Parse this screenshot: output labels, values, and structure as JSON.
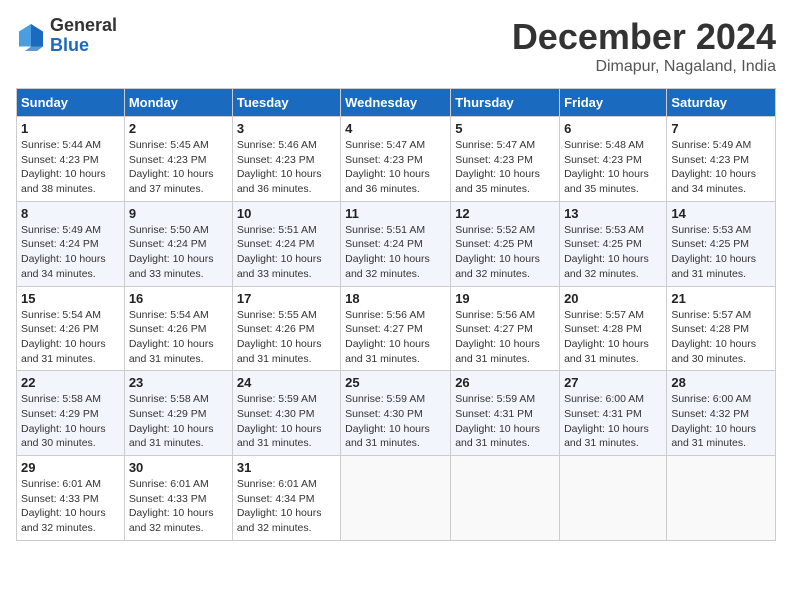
{
  "header": {
    "logo_general": "General",
    "logo_blue": "Blue",
    "month_title": "December 2024",
    "location": "Dimapur, Nagaland, India"
  },
  "days_of_week": [
    "Sunday",
    "Monday",
    "Tuesday",
    "Wednesday",
    "Thursday",
    "Friday",
    "Saturday"
  ],
  "weeks": [
    [
      {
        "day": "1",
        "sunrise": "5:44 AM",
        "sunset": "4:23 PM",
        "daylight": "10 hours and 38 minutes."
      },
      {
        "day": "2",
        "sunrise": "5:45 AM",
        "sunset": "4:23 PM",
        "daylight": "10 hours and 37 minutes."
      },
      {
        "day": "3",
        "sunrise": "5:46 AM",
        "sunset": "4:23 PM",
        "daylight": "10 hours and 36 minutes."
      },
      {
        "day": "4",
        "sunrise": "5:47 AM",
        "sunset": "4:23 PM",
        "daylight": "10 hours and 36 minutes."
      },
      {
        "day": "5",
        "sunrise": "5:47 AM",
        "sunset": "4:23 PM",
        "daylight": "10 hours and 35 minutes."
      },
      {
        "day": "6",
        "sunrise": "5:48 AM",
        "sunset": "4:23 PM",
        "daylight": "10 hours and 35 minutes."
      },
      {
        "day": "7",
        "sunrise": "5:49 AM",
        "sunset": "4:23 PM",
        "daylight": "10 hours and 34 minutes."
      }
    ],
    [
      {
        "day": "8",
        "sunrise": "5:49 AM",
        "sunset": "4:24 PM",
        "daylight": "10 hours and 34 minutes."
      },
      {
        "day": "9",
        "sunrise": "5:50 AM",
        "sunset": "4:24 PM",
        "daylight": "10 hours and 33 minutes."
      },
      {
        "day": "10",
        "sunrise": "5:51 AM",
        "sunset": "4:24 PM",
        "daylight": "10 hours and 33 minutes."
      },
      {
        "day": "11",
        "sunrise": "5:51 AM",
        "sunset": "4:24 PM",
        "daylight": "10 hours and 32 minutes."
      },
      {
        "day": "12",
        "sunrise": "5:52 AM",
        "sunset": "4:25 PM",
        "daylight": "10 hours and 32 minutes."
      },
      {
        "day": "13",
        "sunrise": "5:53 AM",
        "sunset": "4:25 PM",
        "daylight": "10 hours and 32 minutes."
      },
      {
        "day": "14",
        "sunrise": "5:53 AM",
        "sunset": "4:25 PM",
        "daylight": "10 hours and 31 minutes."
      }
    ],
    [
      {
        "day": "15",
        "sunrise": "5:54 AM",
        "sunset": "4:26 PM",
        "daylight": "10 hours and 31 minutes."
      },
      {
        "day": "16",
        "sunrise": "5:54 AM",
        "sunset": "4:26 PM",
        "daylight": "10 hours and 31 minutes."
      },
      {
        "day": "17",
        "sunrise": "5:55 AM",
        "sunset": "4:26 PM",
        "daylight": "10 hours and 31 minutes."
      },
      {
        "day": "18",
        "sunrise": "5:56 AM",
        "sunset": "4:27 PM",
        "daylight": "10 hours and 31 minutes."
      },
      {
        "day": "19",
        "sunrise": "5:56 AM",
        "sunset": "4:27 PM",
        "daylight": "10 hours and 31 minutes."
      },
      {
        "day": "20",
        "sunrise": "5:57 AM",
        "sunset": "4:28 PM",
        "daylight": "10 hours and 31 minutes."
      },
      {
        "day": "21",
        "sunrise": "5:57 AM",
        "sunset": "4:28 PM",
        "daylight": "10 hours and 30 minutes."
      }
    ],
    [
      {
        "day": "22",
        "sunrise": "5:58 AM",
        "sunset": "4:29 PM",
        "daylight": "10 hours and 30 minutes."
      },
      {
        "day": "23",
        "sunrise": "5:58 AM",
        "sunset": "4:29 PM",
        "daylight": "10 hours and 31 minutes."
      },
      {
        "day": "24",
        "sunrise": "5:59 AM",
        "sunset": "4:30 PM",
        "daylight": "10 hours and 31 minutes."
      },
      {
        "day": "25",
        "sunrise": "5:59 AM",
        "sunset": "4:30 PM",
        "daylight": "10 hours and 31 minutes."
      },
      {
        "day": "26",
        "sunrise": "5:59 AM",
        "sunset": "4:31 PM",
        "daylight": "10 hours and 31 minutes."
      },
      {
        "day": "27",
        "sunrise": "6:00 AM",
        "sunset": "4:31 PM",
        "daylight": "10 hours and 31 minutes."
      },
      {
        "day": "28",
        "sunrise": "6:00 AM",
        "sunset": "4:32 PM",
        "daylight": "10 hours and 31 minutes."
      }
    ],
    [
      {
        "day": "29",
        "sunrise": "6:01 AM",
        "sunset": "4:33 PM",
        "daylight": "10 hours and 32 minutes."
      },
      {
        "day": "30",
        "sunrise": "6:01 AM",
        "sunset": "4:33 PM",
        "daylight": "10 hours and 32 minutes."
      },
      {
        "day": "31",
        "sunrise": "6:01 AM",
        "sunset": "4:34 PM",
        "daylight": "10 hours and 32 minutes."
      },
      null,
      null,
      null,
      null
    ]
  ]
}
